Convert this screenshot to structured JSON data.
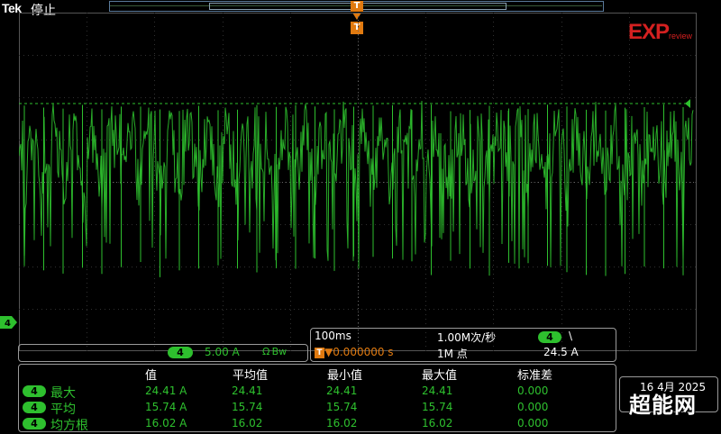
{
  "header": {
    "brand": "Tek",
    "status": "停止",
    "trigger_marker": "T"
  },
  "logo": {
    "main": "EXP",
    "sub": "review"
  },
  "channel": {
    "badge": "4",
    "scale": "5.00 A",
    "bandwidth": "Ω Bw",
    "color": "#2ec02e"
  },
  "timebase": {
    "time_per_div": "100ms",
    "sample_rate": "1.00M次/秒",
    "trigger_position": "▼0.000000 s",
    "trigger_badge_text": "T",
    "record_length": "1M 点",
    "trigger_source": "4",
    "trigger_slope": "\\",
    "trigger_level": "24.5 A"
  },
  "measurements": {
    "headers": [
      "值",
      "平均值",
      "最小值",
      "最大值",
      "标准差"
    ],
    "rows": [
      {
        "badge": "4",
        "label": "最大",
        "values": [
          "24.41 A",
          "24.41",
          "24.41",
          "24.41",
          "0.000"
        ]
      },
      {
        "badge": "4",
        "label": "平均",
        "values": [
          "15.74 A",
          "15.74",
          "15.74",
          "15.74",
          "0.000"
        ]
      },
      {
        "badge": "4",
        "label": "均方根",
        "values": [
          "16.02 A",
          "16.02",
          "16.02",
          "16.02",
          "0.000"
        ]
      }
    ]
  },
  "datetime": "16 4月 2025",
  "watermark": "超能网",
  "colors": {
    "trace": "#2ec02e",
    "trigger": "#e07a10",
    "grid": "#3a3a3a"
  }
}
